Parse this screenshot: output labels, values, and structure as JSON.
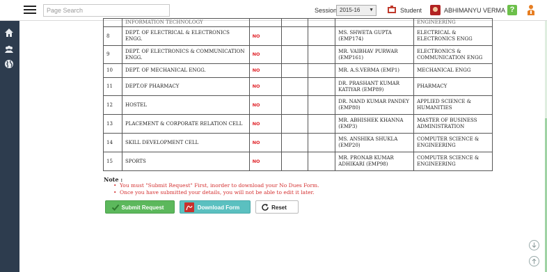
{
  "header": {
    "search_placeholder": "Page Search",
    "session_label": "Session",
    "session_value": "2015-16",
    "student_label": "Student",
    "user_name": "ABHIMANYU VERMA",
    "help_label": "?"
  },
  "sidebar": {
    "items": [
      {
        "icon": "home-icon"
      },
      {
        "icon": "users-icon"
      },
      {
        "icon": "globe-icon"
      }
    ]
  },
  "table": {
    "partial_row": {
      "dept": "INFORMATION TECHNOLOGY",
      "auth_dept": "ENGINEERING"
    },
    "rows": [
      {
        "sno": "8",
        "dept": "DEPT. OF ELECTRICAL & ELECTRONICS ENGG.",
        "status": "NO",
        "authority": "MS. SHWETA GUPTA (EMP174)",
        "auth_dept": "ELECTRICAL & ELECTRONICS ENGG"
      },
      {
        "sno": "9",
        "dept": "DEPT. OF ELECTRONICS & COMMUNICATION ENGG.",
        "status": "NO",
        "authority": "MR. VAIBHAV PURWAR (EMP161)",
        "auth_dept": "ELECTRONICS & COMMUNICATION ENGG"
      },
      {
        "sno": "10",
        "dept": "DEPT. OF MECHANICAL ENGG.",
        "status": "NO",
        "authority": "MR. A.S.VERMA (EMP1)",
        "auth_dept": "MECHANICAL ENGG"
      },
      {
        "sno": "11",
        "dept": "DEPT.OF PHARMACY",
        "status": "NO",
        "authority": "DR. PRASHANT KUMAR KATIYAR (EMP89)",
        "auth_dept": "PHARMACY"
      },
      {
        "sno": "12",
        "dept": "HOSTEL",
        "status": "NO",
        "authority": "DR. NAND KUMAR PANDEY (EMP80)",
        "auth_dept": "APPLIED SCIENCE & HUMANITIES"
      },
      {
        "sno": "13",
        "dept": "PLACEMENT & CORPORATE RELATION CELL",
        "status": "NO",
        "authority": "MR. ABHISHEK KHANNA (EMP3)",
        "auth_dept": "MASTER OF BUSINESS ADMINISTRATION"
      },
      {
        "sno": "14",
        "dept": "SKILL DEVELOPMENT CELL",
        "status": "NO",
        "authority": "MS. ANSHIKA SHUKLA (EMP20)",
        "auth_dept": "COMPUTER SCIENCE & ENGINEERING"
      },
      {
        "sno": "15",
        "dept": "SPORTS",
        "status": "NO",
        "authority": "MR. PRONAB KUMAR ADHIKARI (EMP98)",
        "auth_dept": "COMPUTER SCIENCE & ENGINEERING"
      }
    ]
  },
  "note": {
    "title": "Note :",
    "items": [
      "You must \"Submit Request\" First, inorder to download your No Dues Form.",
      "Once you have submitted your details, you will not be able to edit it later."
    ]
  },
  "actions": {
    "submit_label": "Submit Request",
    "download_label": "Download Form",
    "reset_label": "Reset"
  },
  "colors": {
    "sidebar_bg": "#2d3c4e",
    "status_no": "#e0242a",
    "submit_green": "#5cb85c",
    "download_teal": "#5bc0c0",
    "note_red": "#d43030"
  }
}
